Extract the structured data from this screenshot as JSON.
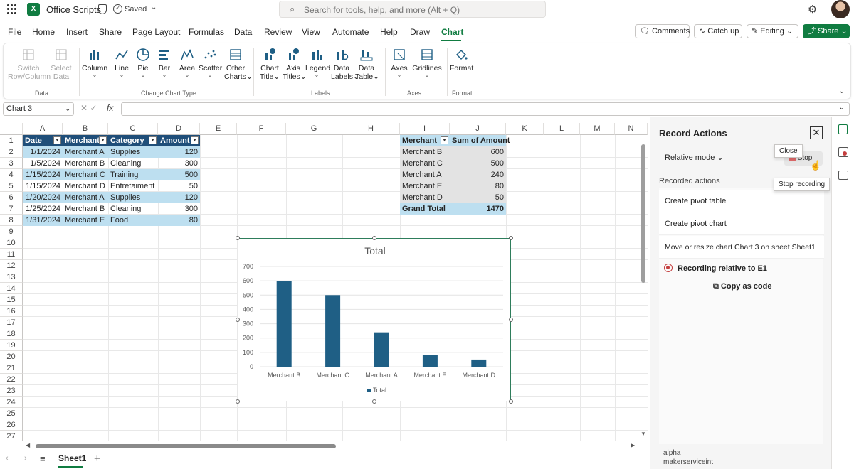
{
  "app": {
    "title": "Office Scripts",
    "status": "Saved",
    "logo_text": "X",
    "search_placeholder": "Search for tools, help, and more (Alt + Q)"
  },
  "menu": [
    "File",
    "Home",
    "Insert",
    "Share",
    "Page Layout",
    "Formulas",
    "Data",
    "Review",
    "View",
    "Automate",
    "Help",
    "Draw",
    "Chart"
  ],
  "active_menu": "Chart",
  "top_buttons": {
    "comments": "Comments",
    "catchup": "Catch up",
    "editing": "Editing",
    "share": "Share"
  },
  "ribbon": {
    "data": {
      "switch": [
        "Switch",
        "Row/Column"
      ],
      "select": [
        "Select",
        "Data"
      ],
      "label": "Data"
    },
    "types": {
      "column": "Column",
      "line": "Line",
      "pie": "Pie",
      "bar": "Bar",
      "area": "Area",
      "scatter": "Scatter",
      "other": [
        "Other",
        "Charts"
      ],
      "label": "Change Chart Type"
    },
    "labels": {
      "chart_title": [
        "Chart",
        "Title"
      ],
      "axis_titles": [
        "Axis",
        "Titles"
      ],
      "legend": "Legend",
      "data_labels": [
        "Data",
        "Labels"
      ],
      "data_table": [
        "Data",
        "Table"
      ],
      "label": "Labels"
    },
    "axes": {
      "axes": "Axes",
      "gridlines": "Gridlines",
      "label": "Axes"
    },
    "format": {
      "format": "Format",
      "label": "Format"
    }
  },
  "formula_bar": {
    "name_box": "Chart 3",
    "fx": "fx",
    "value": ""
  },
  "columns": [
    "A",
    "B",
    "C",
    "D",
    "E",
    "F",
    "G",
    "H",
    "I",
    "J",
    "K",
    "L",
    "M",
    "N"
  ],
  "rows": [
    "1",
    "2",
    "3",
    "4",
    "5",
    "6",
    "7",
    "8",
    "9",
    "10",
    "11",
    "12",
    "13",
    "14",
    "15",
    "16",
    "17",
    "18",
    "19",
    "20",
    "21",
    "22",
    "23",
    "24",
    "25",
    "26",
    "27"
  ],
  "table": {
    "headers": [
      "Date",
      "Merchant",
      "Category",
      "Amount"
    ],
    "rows": [
      [
        "1/1/2024",
        "Merchant A",
        "Supplies",
        "120"
      ],
      [
        "1/5/2024",
        "Merchant B",
        "Cleaning",
        "300"
      ],
      [
        "1/15/2024",
        "Merchant C",
        "Training",
        "500"
      ],
      [
        "1/15/2024",
        "Merchant D",
        "Entretaiment",
        "50"
      ],
      [
        "1/20/2024",
        "Merchant A",
        "Supplies",
        "120"
      ],
      [
        "1/25/2024",
        "Merchant B",
        "Cleaning",
        "300"
      ],
      [
        "1/31/2024",
        "Merchant E",
        "Food",
        "80"
      ]
    ]
  },
  "pivot": {
    "headers": [
      "Merchant",
      "Sum of Amount"
    ],
    "rows": [
      [
        "Merchant B",
        "600"
      ],
      [
        "Merchant C",
        "500"
      ],
      [
        "Merchant A",
        "240"
      ],
      [
        "Merchant E",
        "80"
      ],
      [
        "Merchant D",
        "50"
      ]
    ],
    "total": [
      "Grand Total",
      "1470"
    ]
  },
  "chart_data": {
    "type": "bar",
    "title": "Total",
    "categories": [
      "Merchant B",
      "Merchant C",
      "Merchant A",
      "Merchant E",
      "Merchant D"
    ],
    "series": [
      {
        "name": "Total",
        "values": [
          600,
          500,
          240,
          80,
          50
        ]
      }
    ],
    "ylim": [
      0,
      700
    ],
    "yticks": [
      0,
      100,
      200,
      300,
      400,
      500,
      600,
      700
    ],
    "grid": true,
    "legend": "bottom",
    "color": "#1f5f85"
  },
  "pane": {
    "title": "Record Actions",
    "mode": "Relative mode",
    "stop": "Stop",
    "close_tooltip": "Close",
    "stop_tooltip": "Stop recording",
    "recorded_label": "Recorded actions",
    "actions": [
      "Create pivot table",
      "Create pivot chart",
      "Move or resize chart Chart 3 on sheet Sheet1"
    ],
    "recording_status": "Recording relative to E1",
    "copy_code": "Copy as code",
    "footer": [
      "alpha",
      "makerserviceint"
    ]
  },
  "sheet_tab": "Sheet1",
  "colors": {
    "brand": "#107c41",
    "table_header": "#1f4e79",
    "band": "#bddff0"
  }
}
